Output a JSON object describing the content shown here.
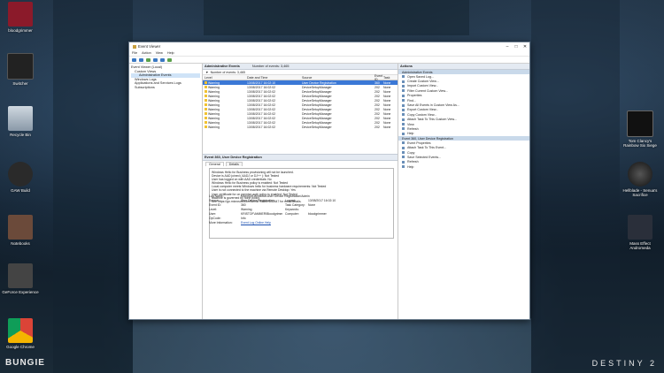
{
  "desktop": {
    "icons_left": [
      {
        "label": "bloodgrimmer"
      },
      {
        "label": "Switcher"
      },
      {
        "label": "Recycle Bin"
      },
      {
        "label": "GAW Build"
      },
      {
        "label": "Notebooks"
      },
      {
        "label": "GeForce Experience"
      },
      {
        "label": "Google Chrome"
      }
    ],
    "icons_right": [
      {
        "label": "Tom Clancy's Rainbow Six Siege"
      },
      {
        "label": "Hellblade - Senua's Sacrifice"
      },
      {
        "label": "Mass Effect Andromeda"
      }
    ],
    "brand_left": "BUNGIE",
    "brand_right": "DESTINY 2"
  },
  "window": {
    "title": "Event Viewer",
    "menu": [
      "File",
      "Action",
      "View",
      "Help"
    ],
    "tree": [
      "Event Viewer (Local)",
      "Custom Views",
      "Administrative Events",
      "Windows Logs",
      "Applications and Services Logs",
      "Subscriptions"
    ],
    "center_title": "Administrative Events",
    "center_count": "Number of events: 3,465",
    "filter_text": "Number of events: 3,465",
    "columns": [
      "Level",
      "Date and Time",
      "Source",
      "Event ID",
      "Task"
    ],
    "events": [
      {
        "level": "Warning",
        "date": "13/08/2017 16:02:10",
        "source": "User Device Registration",
        "id": "360",
        "task": "None"
      },
      {
        "level": "Warning",
        "date": "13/08/2017 16:02:02",
        "source": "DeviceSetupManager",
        "id": "202",
        "task": "None"
      },
      {
        "level": "Warning",
        "date": "13/08/2017 16:02:02",
        "source": "DeviceSetupManager",
        "id": "202",
        "task": "None"
      },
      {
        "level": "Warning",
        "date": "13/08/2017 16:02:02",
        "source": "DeviceSetupManager",
        "id": "202",
        "task": "None"
      },
      {
        "level": "Warning",
        "date": "13/08/2017 16:02:02",
        "source": "DeviceSetupManager",
        "id": "202",
        "task": "None"
      },
      {
        "level": "Warning",
        "date": "13/08/2017 16:02:02",
        "source": "DeviceSetupManager",
        "id": "202",
        "task": "None"
      },
      {
        "level": "Warning",
        "date": "13/08/2017 16:02:02",
        "source": "DeviceSetupManager",
        "id": "202",
        "task": "None"
      },
      {
        "level": "Warning",
        "date": "13/08/2017 16:02:02",
        "source": "DeviceSetupManager",
        "id": "202",
        "task": "None"
      },
      {
        "level": "Warning",
        "date": "13/08/2017 16:02:02",
        "source": "DeviceSetupManager",
        "id": "202",
        "task": "None"
      },
      {
        "level": "Warning",
        "date": "13/08/2017 16:02:02",
        "source": "DeviceSetupManager",
        "id": "202",
        "task": "None"
      },
      {
        "level": "Warning",
        "date": "13/08/2017 16:02:02",
        "source": "DeviceSetupManager",
        "id": "202",
        "task": "None"
      }
    ],
    "detail_title": "Event 360, User Device Registration",
    "tabs": [
      "General",
      "Details"
    ],
    "message_lines": [
      "Windows Hello for Business provisioning will not be launched.",
      "Device is AAD joined ( AADJ or DJ++ ): Not Tested",
      "User has logged on with AAD credentials: No",
      "Windows Hello for Business policy is enabled: Not Tested",
      "Local computer meets Windows hello for business hardware requirements: Not Tested",
      "User is not connected to the machine via Remote Desktop: Yes",
      "User certificate for on premise auth policy is enabled: Not Tested",
      "Machine is governed by none policy.",
      "See https://go.microsoft.com/fwlink/?linkid=832647 for more details."
    ],
    "props": {
      "log_name_label": "Log Name:",
      "log_name": "Microsoft-Windows-User Device Registration/Admin",
      "source_label": "Source:",
      "source": "User Device Registration",
      "logged_label": "Logged:",
      "logged": "13/08/2017 16:02:10",
      "event_id_label": "Event ID:",
      "event_id": "360",
      "task_label": "Task Category:",
      "task": "None",
      "level_label": "Level:",
      "level": "Warning",
      "keywords_label": "Keywords:",
      "keywords": "",
      "user_label": "User:",
      "user": "KRISTOF\\AMMER\\Bloodgrimm",
      "computer_label": "Computer:",
      "computer": "bloodgrimmer",
      "opcode_label": "OpCode:",
      "opcode": "Info",
      "more_label": "More Information:",
      "more": "Event Log Online Help"
    },
    "actions_title": "Actions",
    "action_group1": "Administrative Events",
    "actions1": [
      "Open Saved Log...",
      "Create Custom View...",
      "Import Custom View...",
      "Filter Current Custom View...",
      "Properties",
      "Find...",
      "Save All Events in Custom View As...",
      "Export Custom View...",
      "Copy Custom View...",
      "Attach Task To This Custom View...",
      "View",
      "Refresh",
      "Help"
    ],
    "action_group2": "Event 360, User Device Registration",
    "actions2": [
      "Event Properties",
      "Attach Task To This Event...",
      "Copy",
      "Save Selected Events...",
      "Refresh",
      "Help"
    ]
  }
}
